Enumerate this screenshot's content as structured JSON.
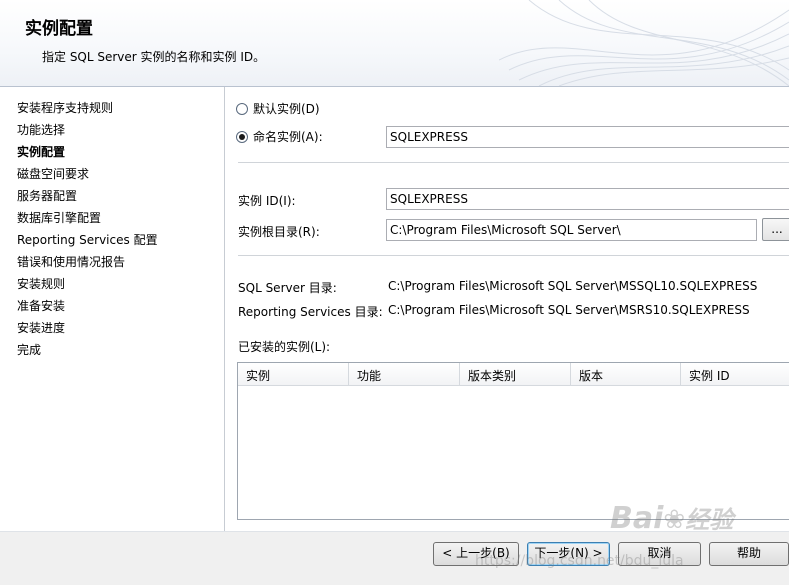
{
  "header": {
    "title": "实例配置",
    "subtitle": "指定 SQL Server 实例的名称和实例 ID。"
  },
  "nav": {
    "items": [
      {
        "label": "安装程序支持规则"
      },
      {
        "label": "功能选择"
      },
      {
        "label": "实例配置"
      },
      {
        "label": "磁盘空间要求"
      },
      {
        "label": "服务器配置"
      },
      {
        "label": "数据库引擎配置"
      },
      {
        "label": "Reporting Services 配置"
      },
      {
        "label": "错误和使用情况报告"
      },
      {
        "label": "安装规则"
      },
      {
        "label": "准备安装"
      },
      {
        "label": "安装进度"
      },
      {
        "label": "完成"
      }
    ],
    "current": "实例配置"
  },
  "form": {
    "default_instance_label": "默认实例(D)",
    "named_instance_label": "命名实例(A):",
    "named_instance_value": "SQLEXPRESS",
    "instance_id_label": "实例 ID(I):",
    "instance_id_value": "SQLEXPRESS",
    "instance_root_label": "实例根目录(R):",
    "instance_root_value": "C:\\Program Files\\Microsoft SQL Server\\",
    "browse_label": "...",
    "sql_dir_label": "SQL Server 目录:",
    "sql_dir_value": "C:\\Program Files\\Microsoft SQL Server\\MSSQL10.SQLEXPRESS",
    "rs_dir_label": "Reporting Services 目录:",
    "rs_dir_value": "C:\\Program Files\\Microsoft SQL Server\\MSRS10.SQLEXPRESS",
    "installed_label": "已安装的实例(L):"
  },
  "grid": {
    "columns": [
      "实例",
      "功能",
      "版本类别",
      "版本",
      "实例 ID"
    ]
  },
  "footer": {
    "back": "< 上一步(B)",
    "next": "下一步(N) >",
    "cancel": "取消",
    "help": "帮助"
  },
  "watermark": {
    "brand_a": "Bai",
    "brand_b": "经验",
    "url": "https://blog.csdn.net/bdu_lula"
  }
}
